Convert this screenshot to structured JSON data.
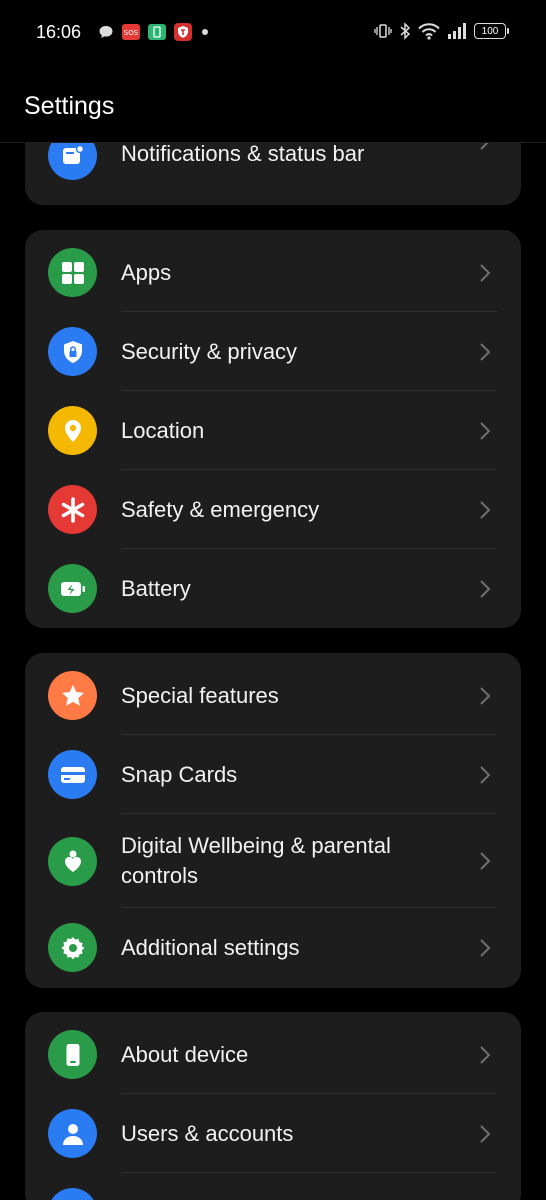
{
  "status_bar": {
    "time": "16:06",
    "battery": "100",
    "notification_icons": [
      "chat-bubble-icon",
      "sos-icon",
      "phone-app-icon",
      "shield-app-icon",
      "dot-icon"
    ],
    "system_icons": [
      "vibrate-icon",
      "bluetooth-icon",
      "wifi-icon",
      "signal-icon",
      "battery-icon"
    ]
  },
  "header": {
    "title": "Settings"
  },
  "colors": {
    "blue": "#2B7BF2",
    "green": "#2A9B48",
    "yellow": "#F5B800",
    "red": "#E53935",
    "orange": "#FF7A45",
    "card": "#1d1d1d"
  },
  "groups": [
    {
      "items": [
        {
          "label": "Notifications & status bar",
          "icon": "notification-icon"
        }
      ]
    },
    {
      "items": [
        {
          "label": "Apps",
          "icon": "apps-grid-icon"
        },
        {
          "label": "Security & privacy",
          "icon": "shield-lock-icon"
        },
        {
          "label": "Location",
          "icon": "location-pin-icon"
        },
        {
          "label": "Safety & emergency",
          "icon": "asterisk-icon"
        },
        {
          "label": "Battery",
          "icon": "battery-charge-icon"
        }
      ]
    },
    {
      "items": [
        {
          "label": "Special features",
          "icon": "star-icon"
        },
        {
          "label": "Snap Cards",
          "icon": "card-icon"
        },
        {
          "label": "Digital Wellbeing & parental controls",
          "icon": "wellbeing-heart-icon"
        },
        {
          "label": "Additional settings",
          "icon": "gear-icon"
        }
      ]
    },
    {
      "items": [
        {
          "label": "About device",
          "icon": "phone-device-icon"
        },
        {
          "label": "Users & accounts",
          "icon": "user-icon"
        }
      ]
    }
  ]
}
